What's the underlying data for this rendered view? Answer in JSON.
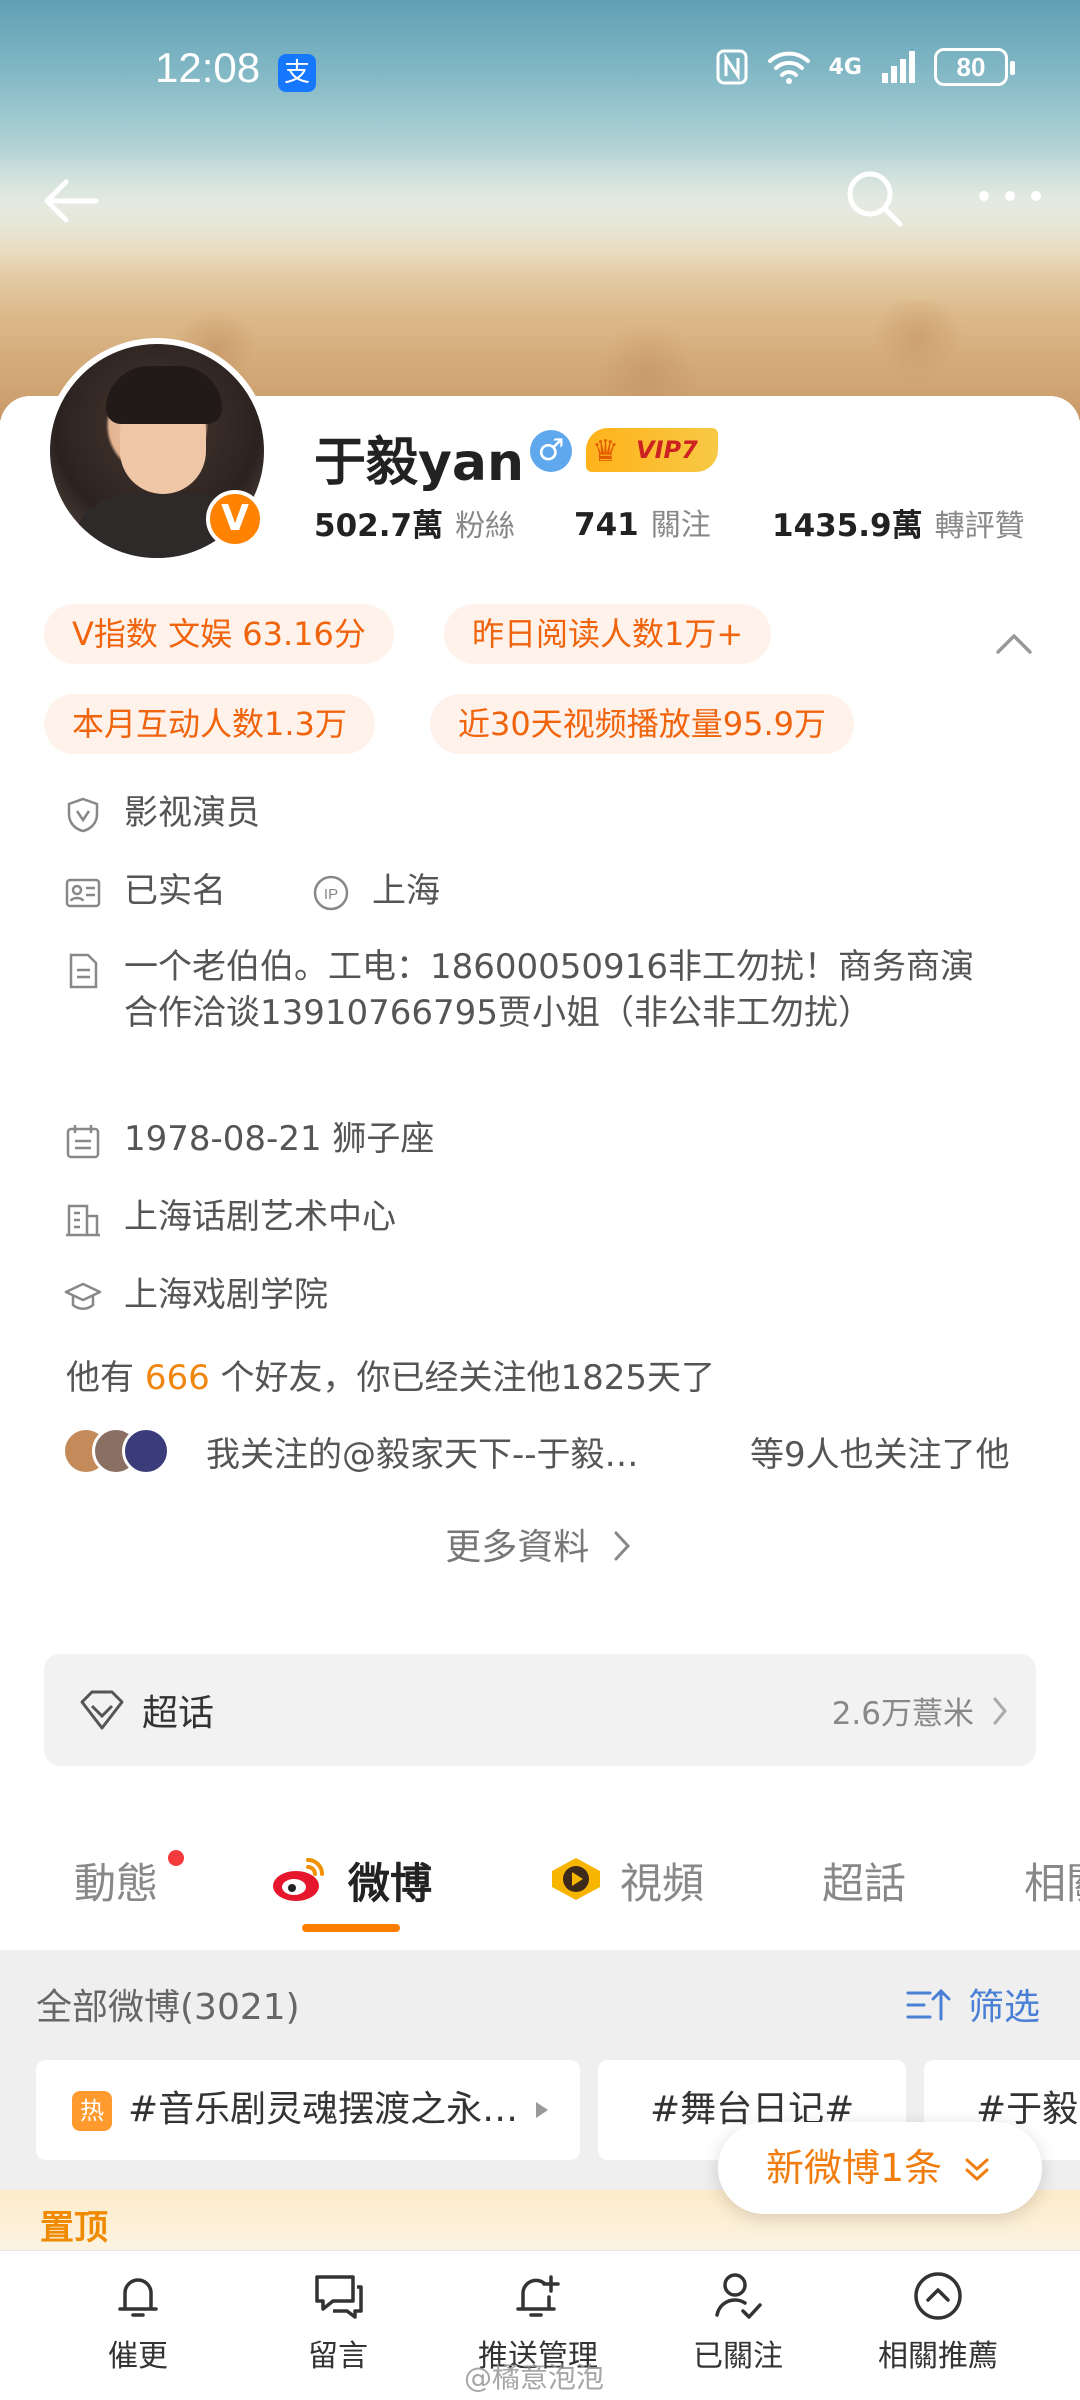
{
  "status_bar": {
    "time": "12:08",
    "alipay_glyph": "支",
    "network": "4G",
    "battery": "80"
  },
  "profile": {
    "name": "于毅yan",
    "gender_glyph": "♂",
    "vip_label": "VIP7",
    "verified_glyph": "V",
    "stats": [
      {
        "value": "502.7萬",
        "label": "粉絲"
      },
      {
        "value": "741",
        "label": "關注"
      },
      {
        "value": "1435.9萬",
        "label": "轉評贊"
      }
    ],
    "tags": [
      "V指数 文娱 63.16分",
      "昨日阅读人数1万+",
      "本月互动人数1.3万",
      "近30天视频播放量95.9万"
    ],
    "occupation": "影视演员",
    "realname": "已实名",
    "ip_location": "上海",
    "bio": "一个老伯伯。工电：18600050916非工勿扰！商务商演合作洽谈13910766795贾小姐（非公非工勿扰）",
    "birthday": "1978-08-21 狮子座",
    "company": "上海话剧艺术中心",
    "school": "上海戏剧学院",
    "friends": {
      "prefix": "他有",
      "count": "666",
      "suffix": "个好友，你已经关注他1825天了"
    },
    "mutual": {
      "text": "我关注的@毅家天下--于毅…",
      "suffix": "等9人也关注了他"
    },
    "more_info": "更多資料"
  },
  "super_topic": {
    "label": "超话",
    "value": "2.6万薏米"
  },
  "tabs": [
    {
      "label": "動態"
    },
    {
      "label": "微博",
      "active": true
    },
    {
      "label": "視頻"
    },
    {
      "label": "超話"
    },
    {
      "label": "相關"
    }
  ],
  "feed": {
    "all_posts": "全部微博(3021)",
    "filter": "筛选",
    "hot_badge": "热",
    "chips": [
      "#音乐剧灵魂摆渡之永…",
      "#舞台日记#",
      "#于毅"
    ],
    "pinned": "置顶",
    "new_post": "新微博1条"
  },
  "bottom_bar": [
    {
      "label": "催更",
      "icon": "bell-icon"
    },
    {
      "label": "留言",
      "icon": "chat-icon"
    },
    {
      "label": "推送管理",
      "icon": "bell-plus-icon"
    },
    {
      "label": "已關注",
      "icon": "user-check-icon"
    },
    {
      "label": "相關推薦",
      "icon": "chevron-up-circle-icon"
    }
  ],
  "watermark": "@橘意泡泡",
  "colors": {
    "accent": "#ff7d00",
    "tag_bg": "#fff2ea",
    "tag_text": "#f0640e",
    "link_blue": "#4a7fd6"
  }
}
